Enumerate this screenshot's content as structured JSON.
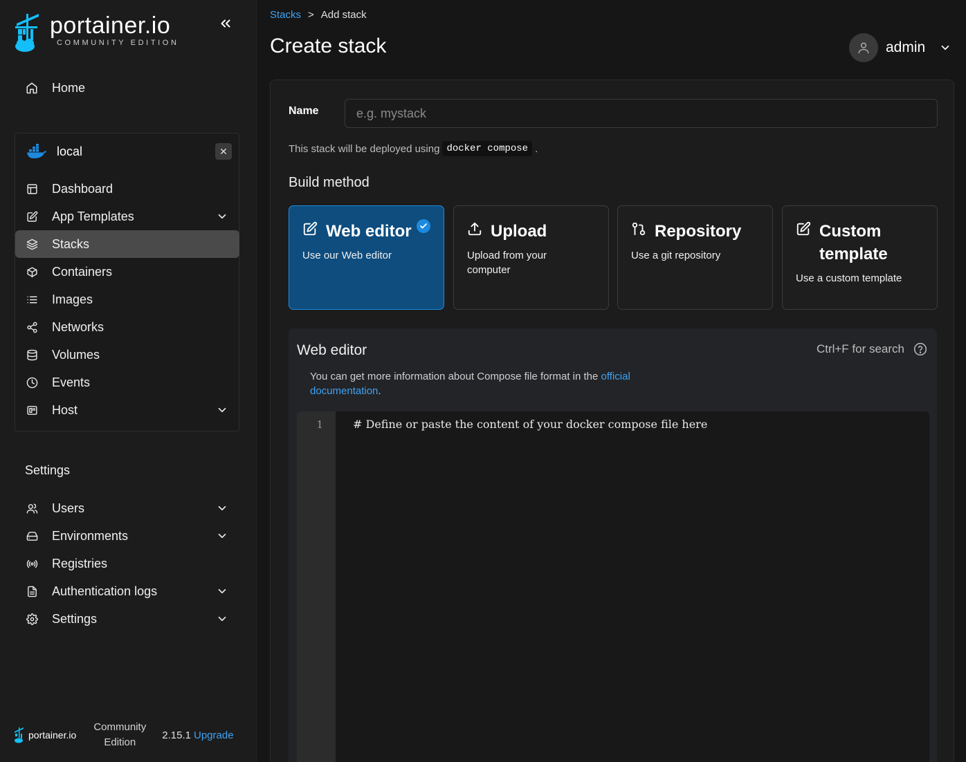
{
  "brand": {
    "title": "portainer.io",
    "subtitle": "COMMUNITY EDITION"
  },
  "sidebar": {
    "home": "Home",
    "environment": {
      "name": "local",
      "items": [
        {
          "label": "Dashboard",
          "icon": "dashboard-icon",
          "chevron": false
        },
        {
          "label": "App Templates",
          "icon": "edit-icon",
          "chevron": true
        },
        {
          "label": "Stacks",
          "icon": "layers-icon",
          "chevron": false,
          "active": true
        },
        {
          "label": "Containers",
          "icon": "box-icon",
          "chevron": false
        },
        {
          "label": "Images",
          "icon": "list-icon",
          "chevron": false
        },
        {
          "label": "Networks",
          "icon": "share-icon",
          "chevron": false
        },
        {
          "label": "Volumes",
          "icon": "database-icon",
          "chevron": false
        },
        {
          "label": "Events",
          "icon": "clock-icon",
          "chevron": false
        },
        {
          "label": "Host",
          "icon": "cpu-icon",
          "chevron": true
        }
      ]
    },
    "settings_title": "Settings",
    "settings_items": [
      {
        "label": "Users",
        "icon": "users-icon",
        "chevron": true
      },
      {
        "label": "Environments",
        "icon": "hdd-icon",
        "chevron": true
      },
      {
        "label": "Registries",
        "icon": "radio-icon",
        "chevron": false
      },
      {
        "label": "Authentication logs",
        "icon": "file-text-icon",
        "chevron": true
      },
      {
        "label": "Settings",
        "icon": "gear-icon",
        "chevron": true
      }
    ],
    "footer": {
      "brand": "portainer.io",
      "edition": "Community Edition",
      "version": "2.15.1",
      "upgrade": "Upgrade"
    }
  },
  "header": {
    "breadcrumb": {
      "parent": "Stacks",
      "separator": ">",
      "current": "Add stack"
    },
    "title": "Create stack",
    "user": "admin"
  },
  "form": {
    "name_label": "Name",
    "name_placeholder": "e.g. mystack",
    "deploy_note_prefix": "This stack will be deployed using",
    "deploy_note_code": "docker compose",
    "deploy_note_suffix": ".",
    "build_method_title": "Build method",
    "options": [
      {
        "title": "Web editor",
        "desc": "Use our Web editor",
        "icon": "edit-icon",
        "selected": true
      },
      {
        "title": "Upload",
        "desc": "Upload from your computer",
        "icon": "upload-icon",
        "selected": false
      },
      {
        "title": "Repository",
        "desc": "Use a git repository",
        "icon": "git-pull-request-icon",
        "selected": false
      },
      {
        "title": "Custom template",
        "desc": "Use a custom template",
        "icon": "edit-icon",
        "selected": false
      }
    ]
  },
  "editor": {
    "title": "Web editor",
    "search_hint": "Ctrl+F for search",
    "info_prefix": "You can get more information about Compose file format in the",
    "info_link_1": "official",
    "info_link_2": "documentation",
    "info_suffix": ".",
    "line_number": "1",
    "content": "# Define or paste the content of your docker compose file here"
  },
  "colors": {
    "accent": "#3ea3f5",
    "selected_card": "#0e4d7e",
    "selected_border": "#1d8ae0",
    "background": "#161616"
  }
}
